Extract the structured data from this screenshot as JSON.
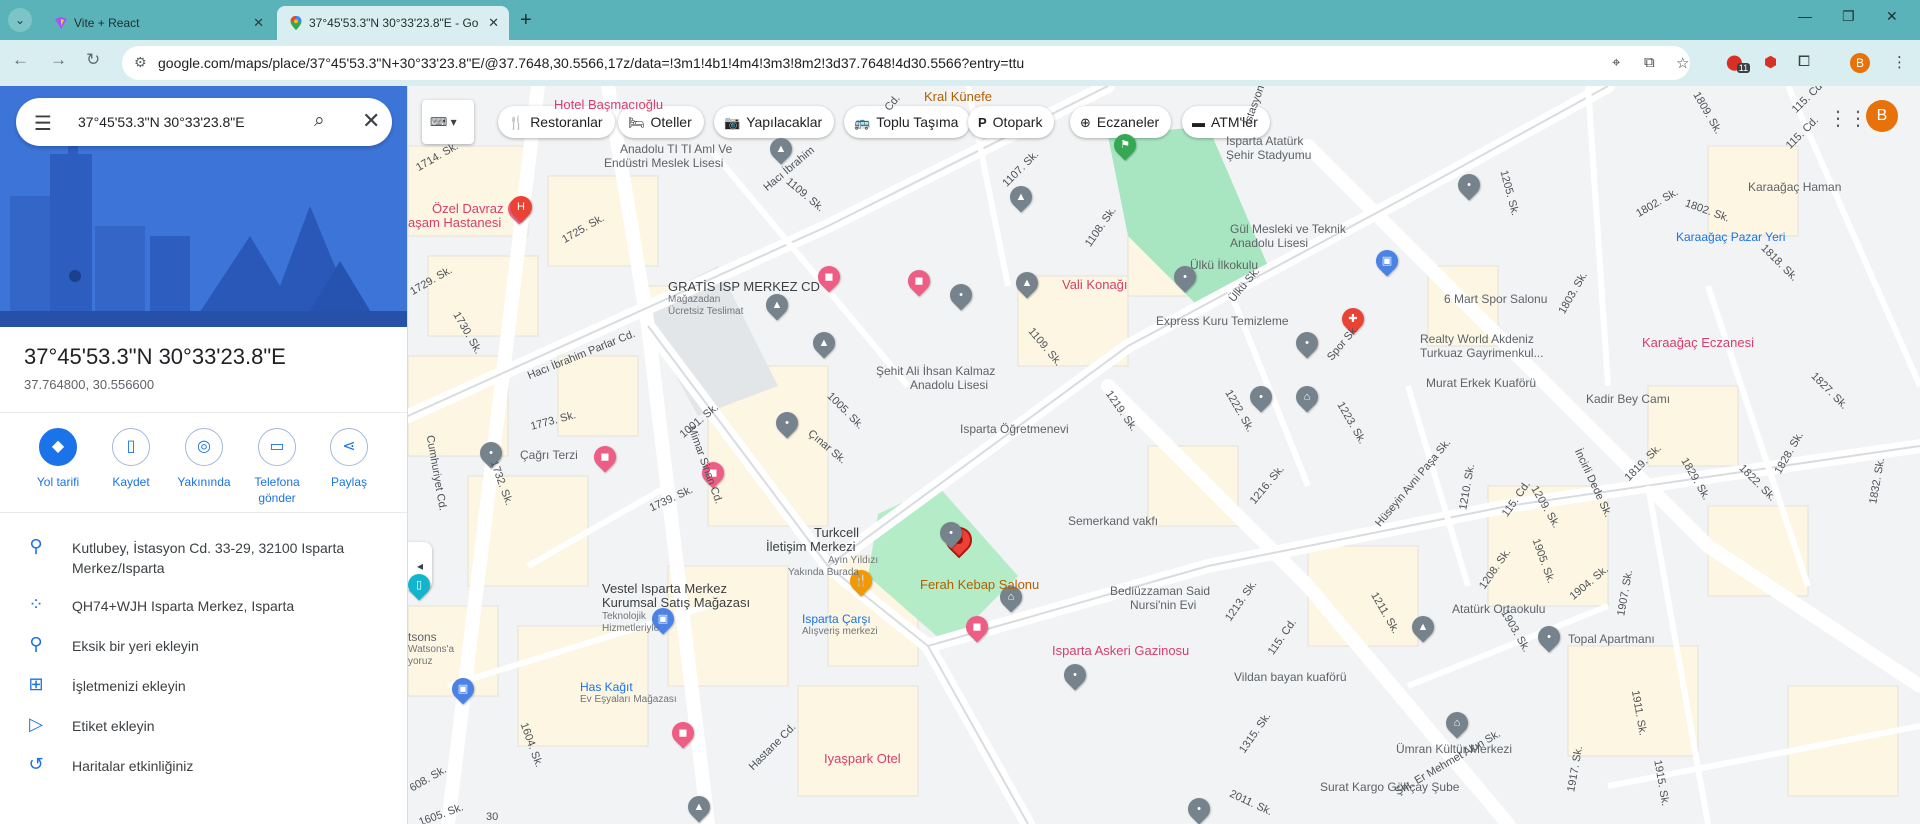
{
  "browser": {
    "tabs": [
      {
        "title": "Vite + React",
        "active": false
      },
      {
        "title": "37°45'53.3\"N 30°33'23.8\"E - Go",
        "active": true
      }
    ],
    "url": "google.com/maps/place/37°45'53.3\"N+30°33'23.8\"E/@37.7648,30.5566,17z/data=!3m1!4b1!4m4!3m3!8m2!3d37.7648!4d30.5566?entry=ttu",
    "extension_badge": "11",
    "profile_initial": "B"
  },
  "search": {
    "value": "37°45'53.3\"N 30°33'23.8\"E"
  },
  "place": {
    "title": "37°45'53.3\"N 30°33'23.8\"E",
    "coords": "37.764800, 30.556600"
  },
  "actions": [
    {
      "label": "Yol tarifi",
      "icon": "directions-icon"
    },
    {
      "label": "Kaydet",
      "icon": "bookmark-icon"
    },
    {
      "label": "Yakınında",
      "icon": "nearby-icon"
    },
    {
      "label": "Telefona gönder",
      "icon": "send-to-phone-icon"
    },
    {
      "label": "Paylaş",
      "icon": "share-icon"
    }
  ],
  "info": [
    {
      "text": "Kutlubey, İstasyon Cd. 33-29, 32100 Isparta Merkez/Isparta",
      "icon": "location-icon"
    },
    {
      "text": "QH74+WJH Isparta Merkez, Isparta",
      "icon": "plus-code-icon"
    },
    {
      "text": "Eksik bir yeri ekleyin",
      "icon": "add-place-icon"
    },
    {
      "text": "İşletmenizi ekleyin",
      "icon": "add-business-icon"
    },
    {
      "text": "Etiket ekleyin",
      "icon": "label-icon"
    },
    {
      "text": "Haritalar etkinliğiniz",
      "icon": "history-icon"
    }
  ],
  "chips": [
    "Restoranlar",
    "Oteller",
    "Yapılacaklar",
    "Toplu Taşıma",
    "Otopark",
    "Eczaneler",
    "ATM'ler"
  ],
  "map_labels": {
    "hotel_basmacioglu": "Hotel Başmacıoğlu",
    "kral_kunefe": "Kral Künefe",
    "anadolu_ti": "Anadolu TI TI Aml Ve",
    "endustri": "Endüstri Meslek Lisesi",
    "ozel_davraz": "Özel Davraz",
    "yasam_hastanesi": "aşam Hastanesi",
    "gratis": "GRATİS ISP MERKEZ CD",
    "magazadan": "Mağazadan",
    "ucretsiz": "Ücretsiz Teslimat",
    "vali_konagi": "Vali Konağı",
    "isparta_ataturk": "Isparta Atatürk",
    "sehir_stadyumu": "Şehir Stadyumu",
    "gul_mesleki": "Gül Mesleki ve Teknik",
    "anadolu_lisesi": "Anadolu Lisesi",
    "ulku_ilkokulu": "Ülkü İlkokulu",
    "express_kuru": "Express Kuru Temizleme",
    "alti_mart": "6 Mart Spor Salonu",
    "karaagac_pazar": "Karaağaç Pazar Yeri",
    "karaagac_haman": "Karaağaç Haman",
    "karaagac_eczanesi": "Karaağaç Eczanesi",
    "realty_world": "Realty World Akdeniz",
    "turkuaz": "Turkuaz Gayrimenkul...",
    "murat_erkek": "Murat Erkek Kuaförü",
    "kadir_bey": "Kadir Bey Camı",
    "sehit_ali": "Şehit Ali İhsan Kalmaz",
    "anadolu_lisesi2": "Anadolu Lisesi",
    "isparta_ogretmenevi": "Isparta Öğretmenevi",
    "cagri_terzi": "Çağrı Terzi",
    "turkcell": "Turkcell",
    "iletisim": "İletişim Merkezi",
    "ayin_yildizi": "Ayın Yıldızı",
    "yakinda_burada": "Yakında Burada",
    "semerkand": "Semerkand vakfı",
    "bediuzzaman": "Bediüzzaman Said",
    "nursinin": "Nursi'nin Evi",
    "ferah_kebap": "Ferah Kebap Salonu",
    "isparta_askeri": "Isparta Askeri Gazinosu",
    "vestel": "Vestel Isparta Merkez",
    "kurumsal": "Kurumsal Satış Mağazası",
    "teknolojik": "Teknolojik",
    "hizmetleriyle": "Hizmetleriyle",
    "isparta_carsi": "Isparta Çarşı",
    "alisveris": "Alışveriş merkezi",
    "has_kagit": "Has Kağıt",
    "ev_esyalari": "Ev Eşyaları Mağazası",
    "vildan": "Vildan bayan kuaförü",
    "ataturk_ortaokulu": "Atatürk Ortaokulu",
    "topal_apartmani": "Topal Apartmanı",
    "umran_kultur": "Ümran Kültür Merkezi",
    "surat_kargo": "Surat Kargo Gökçay Şube",
    "iyaspark": "Iyaşpark Otel",
    "watsons1": "tsons",
    "watsons2": "Watsons'a",
    "watsons3": "yoruz"
  },
  "streets": {
    "s1714": "1714. Sk.",
    "s1725": "1725. Sk.",
    "s1729": "1729. Sk.",
    "s1730": "1730. Sk.",
    "haci_ibrahim": "Hacı İbrahim Parlar Cd.",
    "s1773": "1773. Sk.",
    "cumhuriyet": "Cumhuriyet Cd.",
    "s1732": "1732. Sk.",
    "s1739": "1739. Sk.",
    "mimar_sinan": "Mimar Sinan Cd.",
    "s1001": "1001. Sk.",
    "s1005": "1005. Sk.",
    "cinar": "Çınar Sk.",
    "s1109": "1109. Sk.",
    "s1108": "1108. Sk.",
    "s1107": "1107. Sk.",
    "s1109b": "1109. Sk.",
    "s1219": "1219. Sk.",
    "ulku": "Ülkü Sk.",
    "s1222": "1222. Sk.",
    "s1223": "1223. Sk.",
    "spor": "Spor Sk.",
    "s1216": "1216. Sk.",
    "huseyin": "Hüseyin Avni Paşa Sk.",
    "s1210": "1210. Sk.",
    "s115": "115. Cd.",
    "s1209": "1209. Sk.",
    "incirli": "İncirli Dede Sk.",
    "s1819": "1819. Sk.",
    "s1829": "1829. Sk.",
    "s1822": "1822. Sk.",
    "s1828": "1828. Sk.",
    "s1832": "1832. Sk.",
    "s1803": "1803. Sk.",
    "s1802": "1802. Sk.",
    "s1818": "1818. Sk.",
    "s1205": "1205. Sk.",
    "s1809": "1809. Sk.",
    "s115b": "115. Cd.",
    "s1827": "1827. Sk.",
    "s1213": "1213. Sk.",
    "s1211": "1211. Sk.",
    "s1208": "1208. Sk.",
    "s1905": "1905. Sk.",
    "s1904": "1904. Sk.",
    "s1907": "1907. Sk.",
    "s1903": "1903. Sk.",
    "s115c": "115. Cd.",
    "s1315": "1315. Sk.",
    "s2011": "2011. Sk.",
    "er_mehmet": "Şht. Er Mehmet Akın Sk.",
    "s1917": "1917. Sk.",
    "s1911": "1911. Sk.",
    "s1915": "1915. Sk.",
    "hastane": "Hastane Cd.",
    "s1604": "1604. Sk.",
    "s1605": "1605. Sk.",
    "s1608": "608. Sk.",
    "s30": "30",
    "s1802b": "1802. Sk.",
    "istasyon": "İstasyon",
    "s115d": "115. Cd.",
    "cd": "Cd.",
    "haci_ibrahim2": "Hacı İbrahim"
  },
  "colors": {
    "chrome_tab": "#5ab3b8",
    "chrome_bar": "#d9eef0",
    "accent": "#1a73e8",
    "pin_red": "#ea4335",
    "park_green": "#a8e6c1",
    "map_bg": "#f2efe9"
  }
}
